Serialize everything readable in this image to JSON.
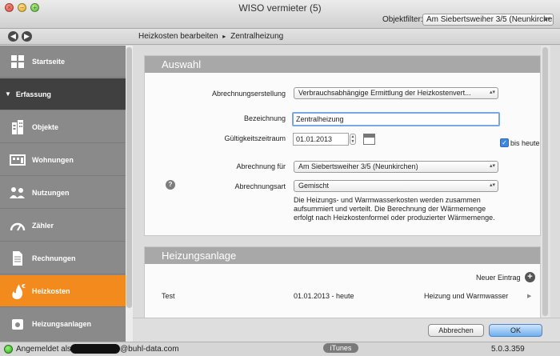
{
  "window": {
    "title": "WISO vermieter (5)"
  },
  "objektfilter": {
    "label": "Objektfilter:",
    "value": "Am Siebertsweiher 3/5 (Neunkirchen)"
  },
  "breadcrumb": {
    "parent": "Heizkosten bearbeiten",
    "separator": "▸",
    "current": "Zentralheizung"
  },
  "sidebar": {
    "items": [
      {
        "label": "Startseite",
        "icon": "grid-icon"
      },
      {
        "label": "Erfassung",
        "icon": "triangle-down-icon"
      },
      {
        "label": "Objekte",
        "icon": "building-icon"
      },
      {
        "label": "Wohnungen",
        "icon": "apartment-icon"
      },
      {
        "label": "Nutzungen",
        "icon": "people-icon"
      },
      {
        "label": "Zähler",
        "icon": "meter-icon"
      },
      {
        "label": "Rechnungen",
        "icon": "document-icon"
      },
      {
        "label": "Heizkosten",
        "icon": "flame-icon"
      },
      {
        "label": "Heizungsanlagen",
        "icon": "boiler-icon"
      }
    ],
    "active_color": "#f28a1e"
  },
  "auswahl": {
    "title": "Auswahl",
    "abrechnungserstellung_label": "Abrechnungserstellung",
    "abrechnungserstellung_value": "Verbrauchsabhängige Ermittlung der Heizkostenvert...",
    "bezeichnung_label": "Bezeichnung",
    "bezeichnung_value": "Zentralheizung",
    "gueltigkeit_label": "Gültigkeitszeitraum",
    "gueltigkeit_value": "01.01.2013",
    "bis_heute_label": "bis heute",
    "bis_heute_checked": true,
    "abrechnung_fuer_label": "Abrechnung für",
    "abrechnung_fuer_value": "Am Siebertsweiher 3/5 (Neunkirchen)",
    "abrechnungsart_label": "Abrechnungsart",
    "abrechnungsart_value": "Gemischt",
    "help_symbol": "?",
    "description_lines": [
      "Die Heizungs- und Warmwasserkosten werden zusammen",
      "aufsummiert und verteilt. Die Berechnung der Wärmemenge",
      "erfolgt nach Heizkostenformel oder produzierter Wärmemenge."
    ]
  },
  "heizungsanlage": {
    "title": "Heizungsanlage",
    "new_entry_label": "Neuer Eintrag",
    "rows": [
      {
        "name": "Test",
        "period": "01.01.2013 - heute",
        "type": "Heizung und Warmwasser"
      }
    ]
  },
  "buttons": {
    "cancel": "Abbrechen",
    "ok": "OK"
  },
  "statusbar": {
    "logged_in_prefix": "Angemeldet als",
    "email_suffix": "@buhl-data.com",
    "itunes": "iTunes",
    "version": "5.0.3.359"
  }
}
